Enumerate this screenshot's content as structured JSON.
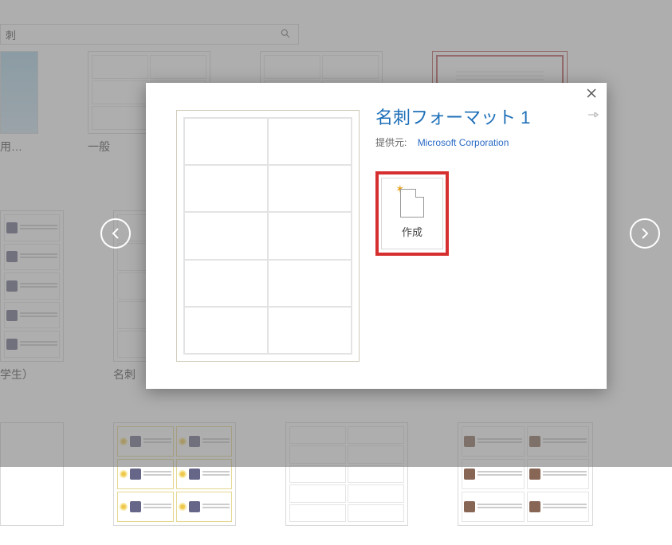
{
  "search": {
    "value": "刺"
  },
  "gallery": {
    "row1": [
      {
        "caption": "用…"
      },
      {
        "caption": "一般"
      },
      {
        "caption": ""
      },
      {
        "caption": ""
      },
      {
        "caption": ""
      }
    ],
    "row2": [
      {
        "caption": "学生）"
      },
      {
        "caption": "名刺"
      }
    ]
  },
  "modal": {
    "title": "名刺フォーマット 1",
    "provider_label": "提供元:",
    "provider_name": "Microsoft Corporation",
    "create_label": "作成"
  }
}
